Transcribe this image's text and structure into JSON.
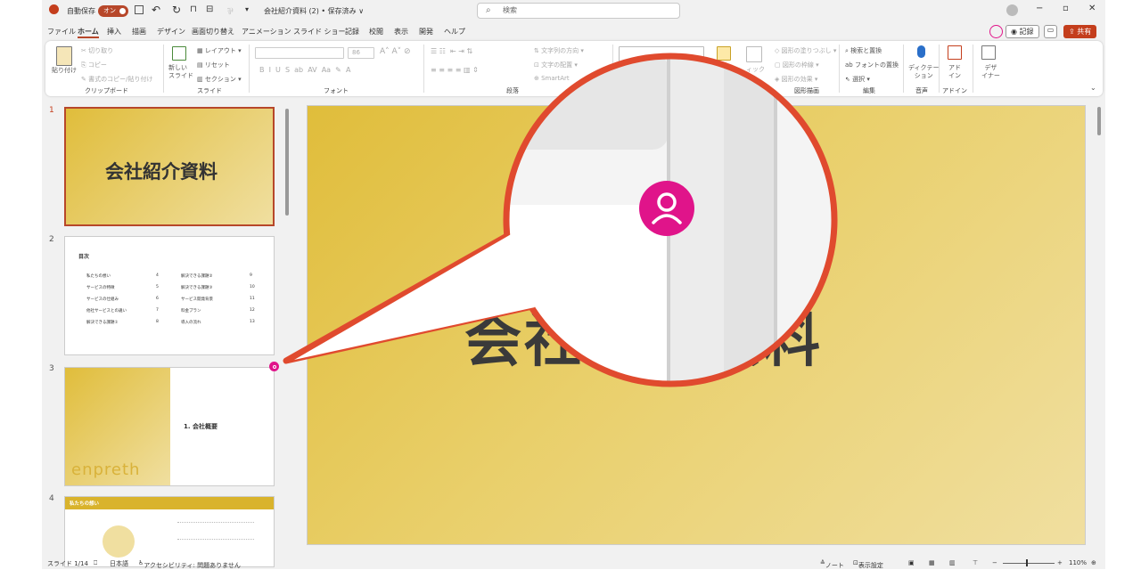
{
  "titlebar": {
    "autosave_label": "自動保存",
    "autosave_state": "オン",
    "doc_title": "会社紹介資料 (2) • 保存済み ∨",
    "search_placeholder": "検索"
  },
  "tabs": [
    "ファイル",
    "ホーム",
    "挿入",
    "描画",
    "デザイン",
    "画面切り替え",
    "アニメーション",
    "スライド ショー",
    "記録",
    "校閲",
    "表示",
    "開発",
    "ヘルプ"
  ],
  "ribbon_actions": {
    "record": "記録",
    "share": "共有"
  },
  "ribbon": {
    "clipboard": {
      "paste": "貼り付け",
      "cut": "切り取り",
      "copy": "コピー",
      "format_painter": "書式のコピー/貼り付け",
      "group": "クリップボード"
    },
    "slides": {
      "new_slide": "新しい\nスライド",
      "layout": "レイアウト",
      "reset": "リセット",
      "section": "セクション",
      "group": "スライド"
    },
    "font": {
      "size": "86",
      "group": "フォント"
    },
    "paragraph": {
      "text_direction": "文字列の方向",
      "align_text": "文字の配置",
      "smartart": "SmartArt",
      "group": "段落"
    },
    "drawing": {
      "quick_styles": "ィック",
      "shape_fill": "図形の塗りつぶし",
      "shape_outline": "図形の枠線",
      "shape_effects": "図形の効果",
      "group": "図形描画"
    },
    "editing": {
      "find_replace": "検索と置換",
      "font_replace": "フォントの置換",
      "select": "選択",
      "group": "編集"
    },
    "voice": {
      "dictate": "ディクテー\nション",
      "group": "音声"
    },
    "addins": {
      "addins": "アド\nイン",
      "group": "アドイン"
    },
    "designer": {
      "designer": "デザ\nイナー"
    }
  },
  "thumbnails": {
    "s1_title": "会社紹介資料",
    "s2_heading": "目次",
    "s2_left": [
      [
        "私たちの想い",
        "4"
      ],
      [
        "サービスの特徴",
        "5"
      ],
      [
        "サービスの仕組み",
        "6"
      ],
      [
        "他社サービスとの違い",
        "7"
      ],
      [
        "解決できる課題①",
        "8"
      ]
    ],
    "s2_right": [
      [
        "解決できる課題②",
        "9"
      ],
      [
        "解決できる課題③",
        "10"
      ],
      [
        "サービス開発背景",
        "11"
      ],
      [
        "料金プラン",
        "12"
      ],
      [
        "導入の流れ",
        "13"
      ]
    ],
    "s3_title": "1. 会社概要",
    "s3_logo": "enpreth",
    "s4_header": "私たちの想い"
  },
  "main_slide_title": "会社紹介資料",
  "statusbar": {
    "slide_count": "スライド 1/14",
    "language": "日本語",
    "accessibility": "アクセシビリティ: 問題ありません",
    "notes": "ノート",
    "display_settings": "表示設定",
    "zoom": "110%"
  }
}
